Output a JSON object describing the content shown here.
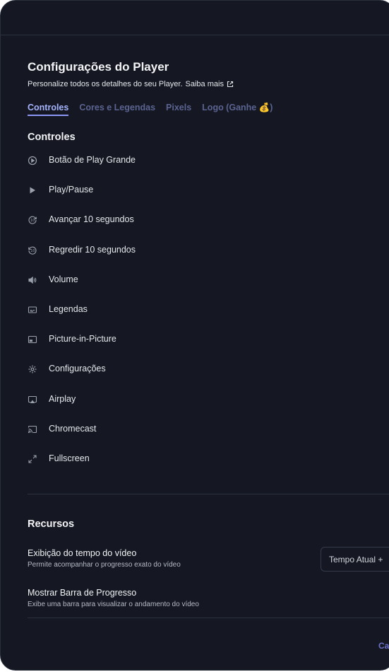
{
  "header": {
    "title": "Configurações do Player",
    "subtitle": "Personalize todos os detalhes do seu Player.",
    "learn_more": "Saiba mais"
  },
  "tabs": [
    {
      "label": "Controles",
      "active": true
    },
    {
      "label": "Cores e Legendas",
      "active": false
    },
    {
      "label": "Pixels",
      "active": false
    },
    {
      "label": "Logo (Ganhe 💰)",
      "active": false
    }
  ],
  "controls": {
    "title": "Controles",
    "items": [
      {
        "label": "Botão de Play Grande",
        "icon": "play-circle-icon"
      },
      {
        "label": "Play/Pause",
        "icon": "play-icon"
      },
      {
        "label": "Avançar 10 segundos",
        "icon": "forward-10-icon"
      },
      {
        "label": "Regredir 10 segundos",
        "icon": "rewind-10-icon"
      },
      {
        "label": "Volume",
        "icon": "volume-icon"
      },
      {
        "label": "Legendas",
        "icon": "captions-icon"
      },
      {
        "label": "Picture-in-Picture",
        "icon": "pip-icon"
      },
      {
        "label": "Configurações",
        "icon": "gear-icon"
      },
      {
        "label": "Airplay",
        "icon": "airplay-icon"
      },
      {
        "label": "Chromecast",
        "icon": "chromecast-icon"
      },
      {
        "label": "Fullscreen",
        "icon": "fullscreen-icon"
      }
    ]
  },
  "resources": {
    "title": "Recursos",
    "features": [
      {
        "name": "Exibição do tempo do vídeo",
        "description": "Permite acompanhar o progresso exato do vídeo"
      },
      {
        "name": "Mostrar Barra de Progresso",
        "description": "Exibe uma barra para visualizar o andamento do vídeo"
      }
    ],
    "time_select_value": "Tempo Atual +"
  },
  "footer": {
    "action_label": "Ca"
  },
  "colors": {
    "background": "#151823",
    "accent": "#a5b4fc",
    "muted_tab": "#5b6390"
  }
}
